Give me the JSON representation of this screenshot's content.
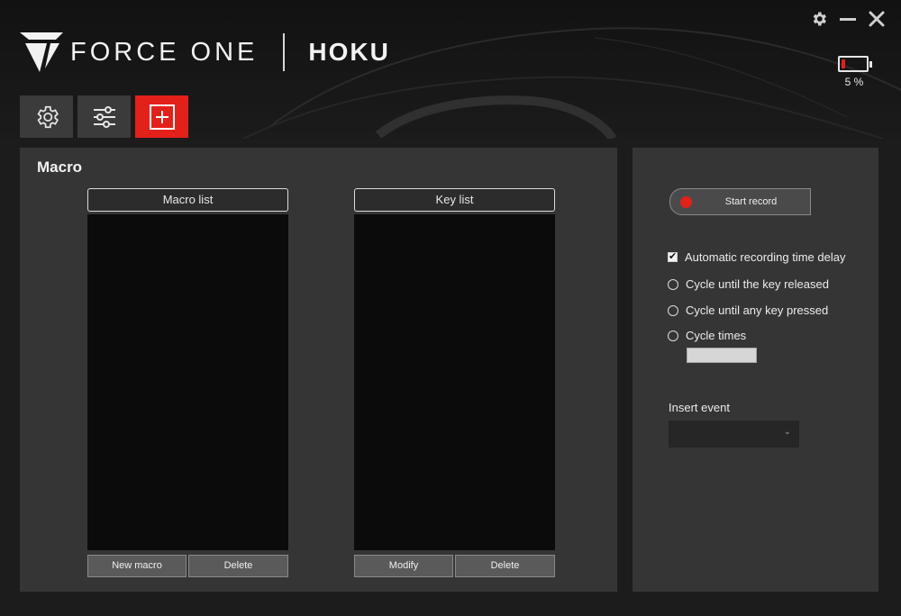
{
  "brand": {
    "name": "FORCE ONE",
    "product": "HOKU"
  },
  "battery": {
    "text": "5 %",
    "level": 0.05,
    "color": "#e4201a"
  },
  "tabs": [
    {
      "icon": "gear-icon",
      "active": false
    },
    {
      "icon": "sliders-icon",
      "active": false
    },
    {
      "icon": "add-macro-icon",
      "active": true
    }
  ],
  "macro": {
    "title": "Macro",
    "macro_list": {
      "header": "Macro list",
      "items": [],
      "new_label": "New macro",
      "delete_label": "Delete"
    },
    "key_list": {
      "header": "Key list",
      "items": [],
      "modify_label": "Modify",
      "delete_label": "Delete"
    }
  },
  "record": {
    "start_label": "Start record",
    "options": {
      "auto_delay": {
        "label": "Automatic recording time delay",
        "checked": true
      },
      "cycle_release": {
        "label": "Cycle until the key released",
        "selected": false
      },
      "cycle_any": {
        "label": "Cycle until any key pressed",
        "selected": false
      },
      "cycle_times": {
        "label": "Cycle times",
        "selected": false,
        "value": ""
      }
    },
    "insert_event": {
      "label": "Insert event",
      "value": ""
    }
  },
  "colors": {
    "accent": "#e4201a",
    "panel": "#353535",
    "background": "#1c1c1c"
  }
}
